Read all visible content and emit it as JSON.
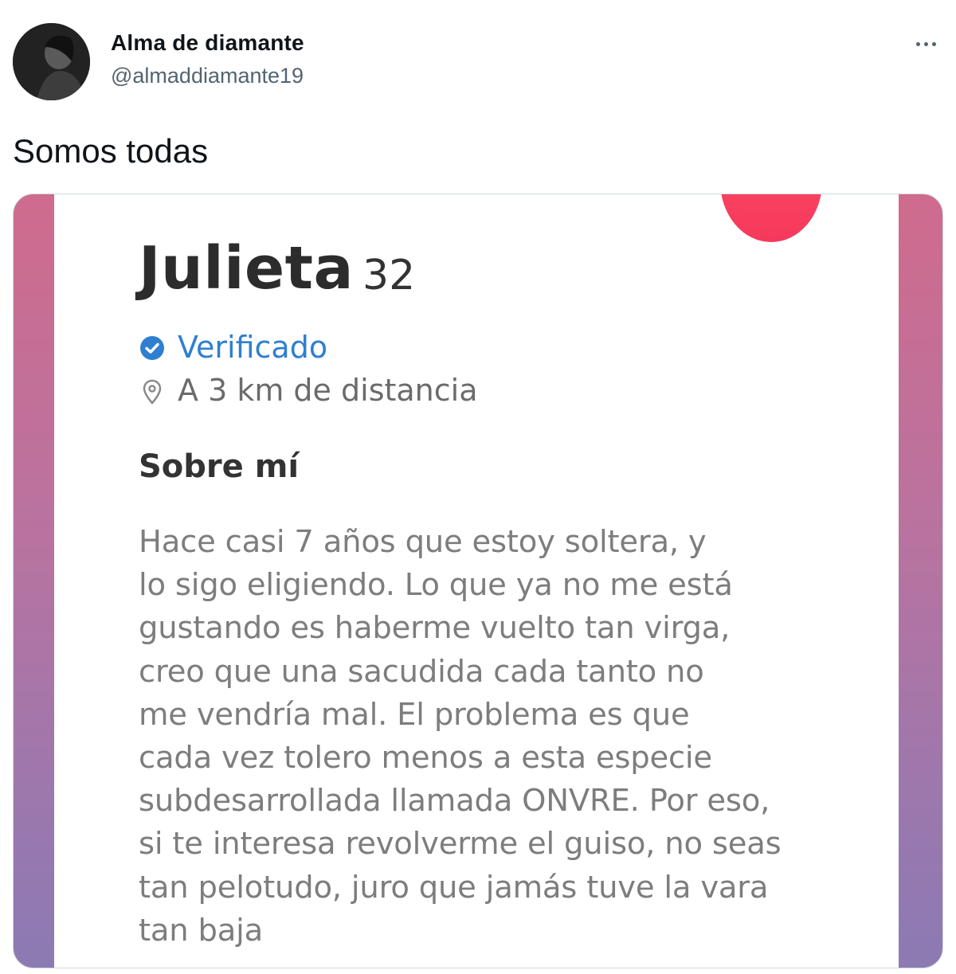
{
  "tweet": {
    "display_name": "Alma de diamante",
    "handle": "@almaddiamante19",
    "text": "Somos todas",
    "more_icon": "more-horizontal-icon"
  },
  "profile_card": {
    "name": "Julieta",
    "age": "32",
    "verified_label": "Verificado",
    "verified_icon": "verified-check-icon",
    "distance_icon": "location-pin-icon",
    "distance": "A 3 km de distancia",
    "about_title": "Sobre mí",
    "bio_lines": [
      "Hace casi 7 años que estoy soltera, y",
      "lo sigo eligiendo. Lo que ya no me está",
      "gustando es haberme vuelto tan virga,",
      "creo que una sacudida cada tanto no",
      "me vendría mal. El problema es que",
      "cada vez tolero menos a esta especie",
      "subdesarrollada llamada ONVRE. Por eso,",
      "si te interesa revolverme el guiso, no seas",
      "tan pelotudo, juro que jamás tuve la vara",
      "tan baja"
    ]
  },
  "colors": {
    "verified_blue": "#2f7fd0",
    "like_badge": "#f5385d",
    "frame_top": "#cf6b8d",
    "frame_bottom": "#8c7ab3"
  }
}
